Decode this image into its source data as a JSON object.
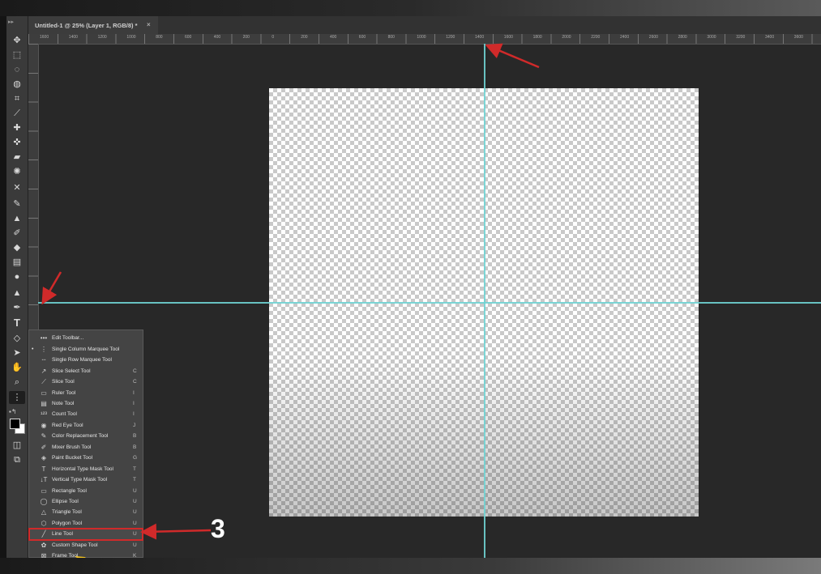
{
  "document": {
    "tab_title": "Untitled-1 @ 25% (Layer 1, RGB/8) *",
    "close_glyph": "×"
  },
  "ruler": {
    "top_ticks": [
      "1600",
      "1400",
      "1200",
      "1000",
      "800",
      "600",
      "400",
      "200",
      "0",
      "200",
      "400",
      "600",
      "800",
      "1000",
      "1200",
      "1400",
      "1600",
      "1800",
      "2000",
      "2200",
      "2400",
      "2600",
      "2800",
      "3000",
      "3200",
      "3400",
      "3600",
      "380"
    ]
  },
  "toolbar": {
    "icons": [
      "move-icon",
      "marquee-icon",
      "lasso-icon",
      "quick-select-icon",
      "crop-icon",
      "eyedropper-icon",
      "healing-brush-icon",
      "spot-heal-icon",
      "patch-icon",
      "frequency-icon",
      "content-aware-icon",
      "brush-icon",
      "stamp-icon",
      "history-brush-icon",
      "eraser-icon",
      "gradient-icon",
      "blur-icon",
      "dodge-icon",
      "pen-icon",
      "type-icon",
      "path-select-icon",
      "hand-icon",
      "zoom-icon",
      "more-tools-icon"
    ]
  },
  "flyout": {
    "items": [
      {
        "dot": "",
        "icon": "more-icon",
        "glyph": "•••",
        "label": "Edit Toolbar...",
        "key": ""
      },
      {
        "dot": "•",
        "icon": "single-column-icon",
        "glyph": "⋮",
        "label": "Single Column Marquee Tool",
        "key": ""
      },
      {
        "dot": "",
        "icon": "single-row-icon",
        "glyph": "┄",
        "label": "Single Row Marquee Tool",
        "key": ""
      },
      {
        "dot": "",
        "icon": "slice-select-icon",
        "glyph": "↗",
        "label": "Slice Select Tool",
        "key": "C"
      },
      {
        "dot": "",
        "icon": "slice-icon",
        "glyph": "⟋",
        "label": "Slice Tool",
        "key": "C"
      },
      {
        "dot": "",
        "icon": "ruler-icon",
        "glyph": "▭",
        "label": "Ruler Tool",
        "key": "I"
      },
      {
        "dot": "",
        "icon": "note-icon",
        "glyph": "▤",
        "label": "Note Tool",
        "key": "I"
      },
      {
        "dot": "",
        "icon": "count-icon",
        "glyph": "¹²³",
        "label": "Count Tool",
        "key": "I"
      },
      {
        "dot": "",
        "icon": "red-eye-icon",
        "glyph": "◉",
        "label": "Red Eye Tool",
        "key": "J"
      },
      {
        "dot": "",
        "icon": "color-replace-icon",
        "glyph": "✎",
        "label": "Color Replacement Tool",
        "key": "B"
      },
      {
        "dot": "",
        "icon": "mixer-brush-icon",
        "glyph": "✐",
        "label": "Mixer Brush Tool",
        "key": "B"
      },
      {
        "dot": "",
        "icon": "paint-bucket-icon",
        "glyph": "◈",
        "label": "Paint Bucket Tool",
        "key": "G"
      },
      {
        "dot": "",
        "icon": "h-type-mask-icon",
        "glyph": "T",
        "label": "Horizontal Type Mask Tool",
        "key": "T"
      },
      {
        "dot": "",
        "icon": "v-type-mask-icon",
        "glyph": "↓T",
        "label": "Vertical Type Mask Tool",
        "key": "T"
      },
      {
        "dot": "",
        "icon": "rectangle-icon",
        "glyph": "▭",
        "label": "Rectangle Tool",
        "key": "U"
      },
      {
        "dot": "",
        "icon": "ellipse-icon",
        "glyph": "◯",
        "label": "Ellipse Tool",
        "key": "U"
      },
      {
        "dot": "",
        "icon": "triangle-icon",
        "glyph": "△",
        "label": "Triangle Tool",
        "key": "U"
      },
      {
        "dot": "",
        "icon": "polygon-icon",
        "glyph": "⬡",
        "label": "Polygon Tool",
        "key": "U"
      },
      {
        "dot": "",
        "icon": "line-icon",
        "glyph": "╱",
        "label": "Line Tool",
        "key": "U"
      },
      {
        "dot": "",
        "icon": "custom-shape-icon",
        "glyph": "✿",
        "label": "Custom Shape Tool",
        "key": "U"
      },
      {
        "dot": "",
        "icon": "frame-icon",
        "glyph": "⊠",
        "label": "Frame Tool",
        "key": "K"
      }
    ]
  },
  "annotation": {
    "step": "3",
    "arrow_color": "#d02a2a"
  },
  "colors": {
    "guide": "#6fd3d3",
    "canvas_bg": "#282828",
    "highlight": "#d02a2a"
  }
}
